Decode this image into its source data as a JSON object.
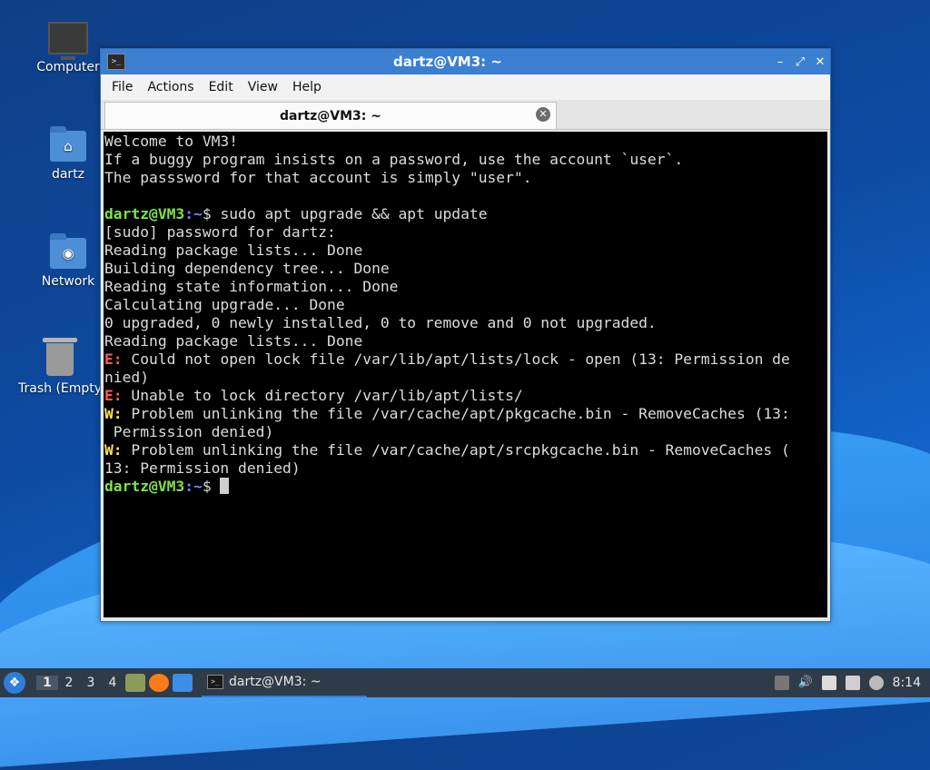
{
  "desktop": {
    "icons": [
      {
        "label": "Computer"
      },
      {
        "label": "dartz"
      },
      {
        "label": "Network"
      },
      {
        "label": "Trash (Empty)"
      }
    ]
  },
  "window": {
    "title": "dartz@VM3: ~",
    "menu": [
      "File",
      "Actions",
      "Edit",
      "View",
      "Help"
    ],
    "tab_title": "dartz@VM3: ~"
  },
  "terminal": {
    "lines": [
      "Welcome to VM3!",
      "If a buggy program insists on a password, use the account `user`.",
      "The passsword for that account is simply \"user\".",
      "",
      "sudo apt upgrade && apt update",
      "[sudo] password for dartz:",
      "Reading package lists... Done",
      "Building dependency tree... Done",
      "Reading state information... Done",
      "Calculating upgrade... Done",
      "0 upgraded, 0 newly installed, 0 to remove and 0 not upgraded.",
      "Reading package lists... Done",
      "Could not open lock file /var/lib/apt/lists/lock - open (13: Permission de",
      "nied)",
      "Unable to lock directory /var/lib/apt/lists/",
      "Problem unlinking the file /var/cache/apt/pkgcache.bin - RemoveCaches (13:",
      " Permission denied)",
      "Problem unlinking the file /var/cache/apt/srcpkgcache.bin - RemoveCaches (",
      "13: Permission denied)"
    ],
    "prompt_user": "dartz@VM3",
    "prompt_path": ":~",
    "prompt_symbol": "$ ",
    "error_prefix": "E:",
    "warning_prefix": "W:"
  },
  "taskbar": {
    "workspaces": [
      "1",
      "2",
      "3",
      "4"
    ],
    "task_title": "dartz@VM3: ~",
    "clock": "8:14"
  }
}
